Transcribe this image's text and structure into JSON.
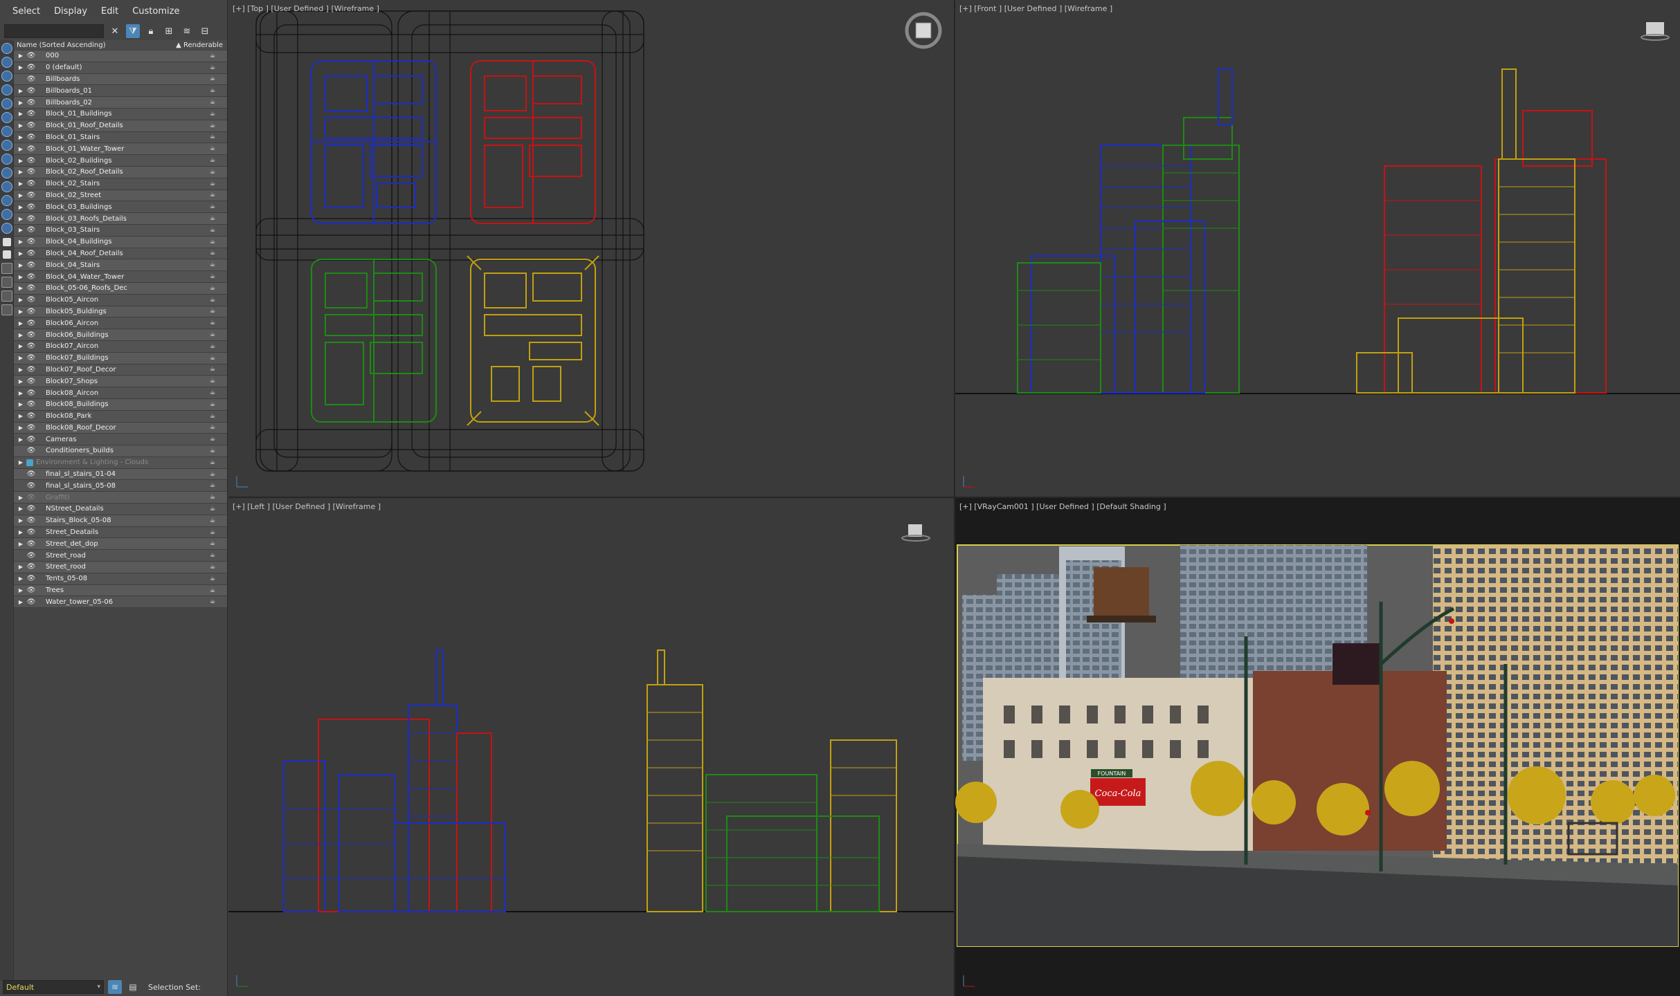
{
  "menu": [
    "Select",
    "Display",
    "Edit",
    "Customize"
  ],
  "explorer": {
    "col_name": "Name (Sorted Ascending)",
    "col_renderable": "▲ Renderable",
    "layers": [
      {
        "name": "000",
        "expand": true
      },
      {
        "name": "0 (default)",
        "expand": true
      },
      {
        "name": "Billboards",
        "expand": false
      },
      {
        "name": "Billboards_01",
        "expand": true
      },
      {
        "name": "Billboards_02",
        "expand": true
      },
      {
        "name": "Block_01_Buildings",
        "expand": true
      },
      {
        "name": "Block_01_Roof_Details",
        "expand": true
      },
      {
        "name": "Block_01_Stairs",
        "expand": true
      },
      {
        "name": "Block_01_Water_Tower",
        "expand": true
      },
      {
        "name": "Block_02_Buildings",
        "expand": true
      },
      {
        "name": "Block_02_Roof_Details",
        "expand": true
      },
      {
        "name": "Block_02_Stairs",
        "expand": true
      },
      {
        "name": "Block_02_Street",
        "expand": true
      },
      {
        "name": "Block_03_Buildings",
        "expand": true
      },
      {
        "name": "Block_03_Roofs_Details",
        "expand": true
      },
      {
        "name": "Block_03_Stairs",
        "expand": true
      },
      {
        "name": "Block_04_Buildings",
        "expand": true
      },
      {
        "name": "Block_04_Roof_Details",
        "expand": true
      },
      {
        "name": "Block_04_Stairs",
        "expand": true
      },
      {
        "name": "Block_04_Water_Tower",
        "expand": true
      },
      {
        "name": "Block_05-06_Roofs_Dec",
        "expand": true
      },
      {
        "name": "Block05_Aircon",
        "expand": true
      },
      {
        "name": "Block05_Buldings",
        "expand": true
      },
      {
        "name": "Block06_Aircon",
        "expand": true
      },
      {
        "name": "Block06_Buildings",
        "expand": true
      },
      {
        "name": "Block07_Aircon",
        "expand": true
      },
      {
        "name": "Block07_Buildings",
        "expand": true
      },
      {
        "name": "Block07_Roof_Decor",
        "expand": true
      },
      {
        "name": "Block07_Shops",
        "expand": true
      },
      {
        "name": "Block08_Aircon",
        "expand": true
      },
      {
        "name": "Block08_Buildings",
        "expand": true
      },
      {
        "name": "Block08_Park",
        "expand": true
      },
      {
        "name": "Block08_Roof_Decor",
        "expand": true
      },
      {
        "name": "Cameras",
        "expand": true
      },
      {
        "name": "Conditioners_builds",
        "expand": false
      },
      {
        "name": "Environment & Lighting - Clouds",
        "expand": true,
        "dim": true,
        "layerset": true
      },
      {
        "name": "final_sl_stairs_01-04",
        "expand": false
      },
      {
        "name": "final_sl_stairs_05-08",
        "expand": false
      },
      {
        "name": "Graffiti",
        "expand": true,
        "dim": true
      },
      {
        "name": "NStreet_Deatails",
        "expand": true
      },
      {
        "name": "Stairs_Block_05-08",
        "expand": true
      },
      {
        "name": "Street_Deatails",
        "expand": true
      },
      {
        "name": "Street_det_dop",
        "expand": true
      },
      {
        "name": "Street_road",
        "expand": false
      },
      {
        "name": "Street_rood",
        "expand": true
      },
      {
        "name": "Tents_05-08",
        "expand": true
      },
      {
        "name": "Trees",
        "expand": true
      },
      {
        "name": "Water_tower_05-06",
        "expand": true
      }
    ]
  },
  "footer": {
    "layer_value": "Default",
    "selection_set": "Selection Set:"
  },
  "viewports": {
    "top": "[+] [Top ] [User Defined ] [Wireframe ]",
    "front": "[+] [Front ] [User Defined ] [Wireframe ]",
    "left": "[+] [Left ] [User Defined ] [Wireframe ]",
    "camera": "[+] [VRayCam001 ] [User Defined ] [Default Shading ]"
  },
  "camera_scene": {
    "billboard_text": "Coca-Cola",
    "sign_text": "FOUNTAIN"
  },
  "colors": {
    "blue": "#1b2cc8",
    "red": "#c81212",
    "green": "#1e8a14",
    "yellow": "#c2a010",
    "accent": "#4c86b8",
    "layer_default": "#e6d85a"
  }
}
